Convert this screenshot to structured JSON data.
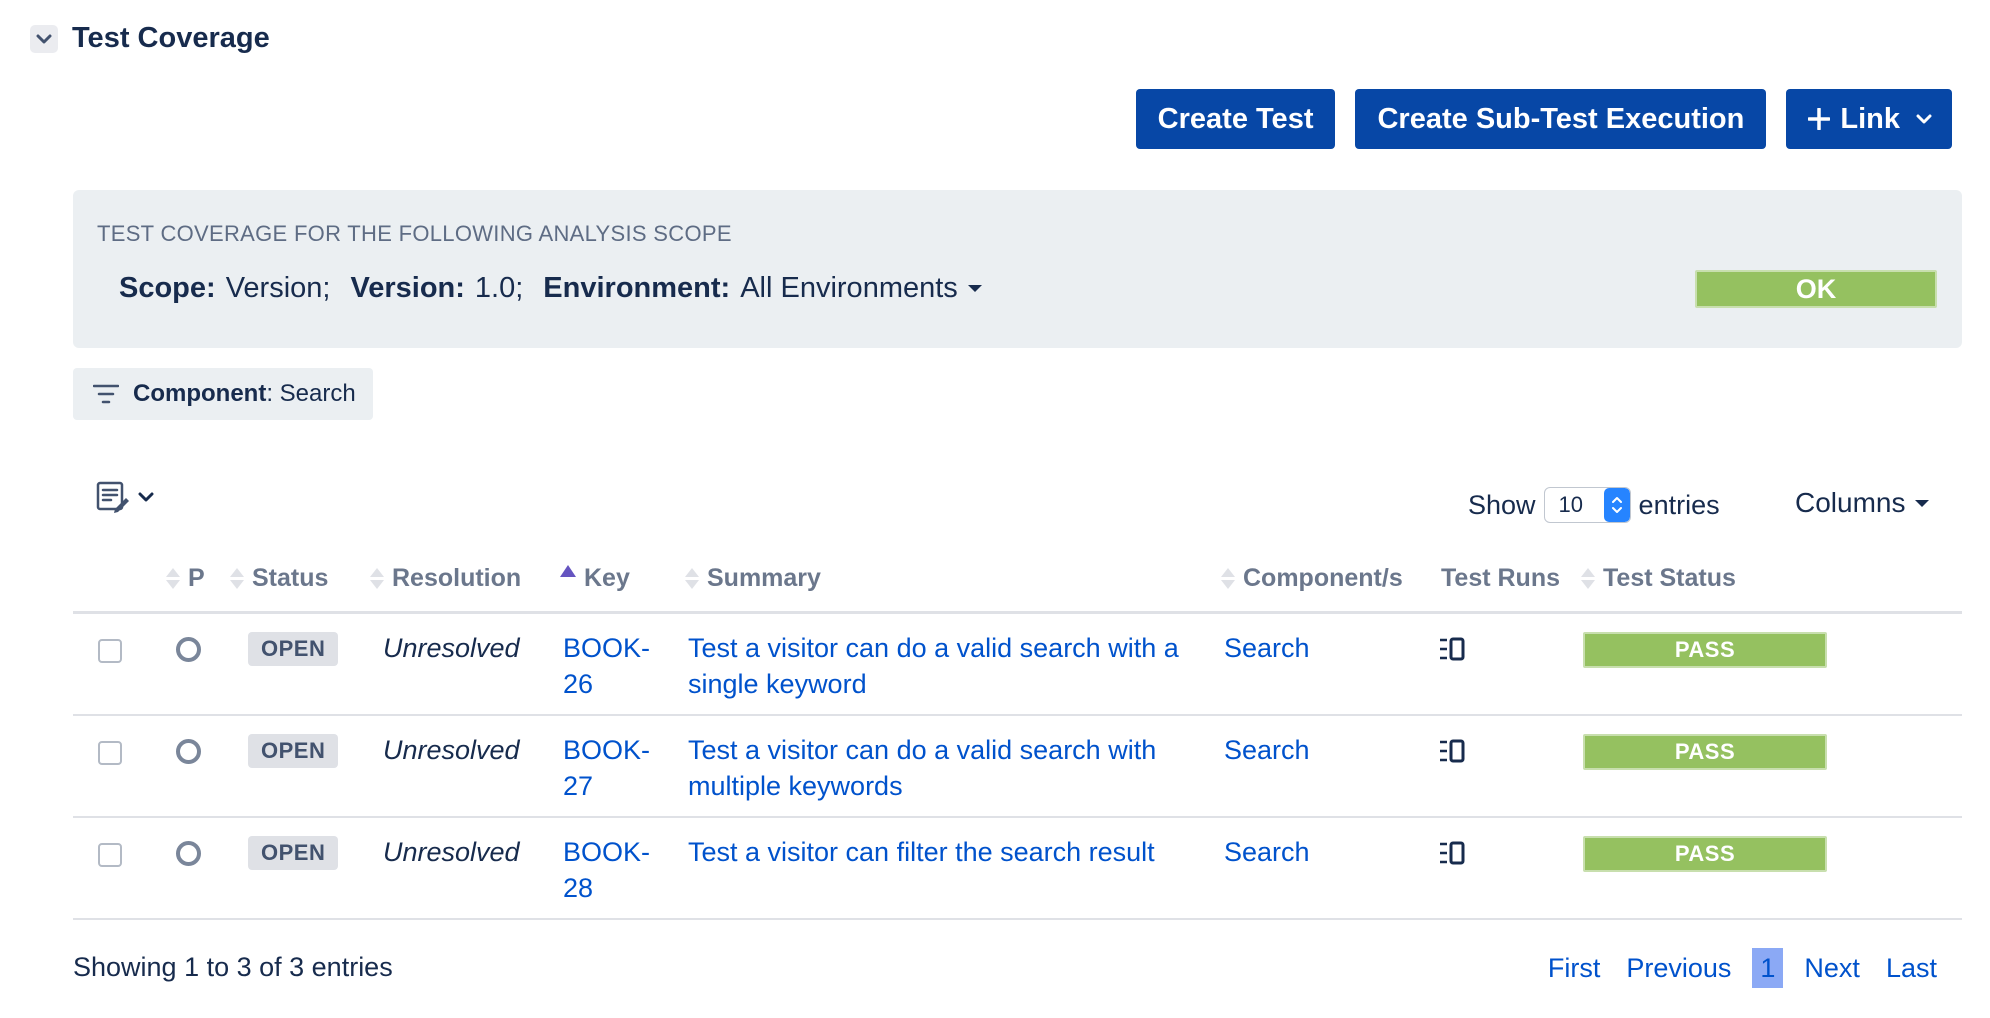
{
  "section": {
    "title": "Test Coverage"
  },
  "actions": {
    "create_test": "Create Test",
    "create_sub_test_execution": "Create Sub-Test Execution",
    "link": "Link"
  },
  "scope": {
    "heading": "TEST COVERAGE FOR THE FOLLOWING ANALYSIS SCOPE",
    "scope_label": "Scope:",
    "scope_value": "Version;",
    "version_label": "Version:",
    "version_value": "1.0;",
    "environment_label": "Environment:",
    "environment_value": "All Environments",
    "status": "OK",
    "status_color": "#95c160"
  },
  "filter": {
    "label": "Component",
    "value": ": Search"
  },
  "toolbar": {
    "show_label": "Show",
    "entries_value": "10",
    "entries_label": "entries",
    "columns_label": "Columns"
  },
  "table": {
    "headers": {
      "priority": "P",
      "status": "Status",
      "resolution": "Resolution",
      "key": "Key",
      "summary": "Summary",
      "components": "Component/s",
      "test_runs": "Test Runs",
      "test_status": "Test Status"
    },
    "rows": [
      {
        "status": "OPEN",
        "resolution": "Unresolved",
        "key": "BOOK-26",
        "summary": "Test a visitor can do a valid search with a single keyword",
        "component": "Search",
        "test_status": "PASS"
      },
      {
        "status": "OPEN",
        "resolution": "Unresolved",
        "key": "BOOK-27",
        "summary": "Test a visitor can do a valid search with multiple keywords",
        "component": "Search",
        "test_status": "PASS"
      },
      {
        "status": "OPEN",
        "resolution": "Unresolved",
        "key": "BOOK-28",
        "summary": "Test a visitor can filter the search result",
        "component": "Search",
        "test_status": "PASS"
      }
    ]
  },
  "footer": {
    "showing": "Showing 1 to 3 of 3 entries",
    "first": "First",
    "previous": "Previous",
    "current_page": "1",
    "next": "Next",
    "last": "Last"
  },
  "icons": {
    "collapse": "chevron-down-icon",
    "plus": "plus-icon",
    "filter": "filter-icon",
    "table_menu": "edit-list-icon",
    "priority": "priority-circle-icon",
    "test_runs": "test-runs-icon"
  },
  "colors": {
    "primary": "#0747a6",
    "link": "#0052cc",
    "pass": "#95c160",
    "panel": "#ebeff2"
  }
}
